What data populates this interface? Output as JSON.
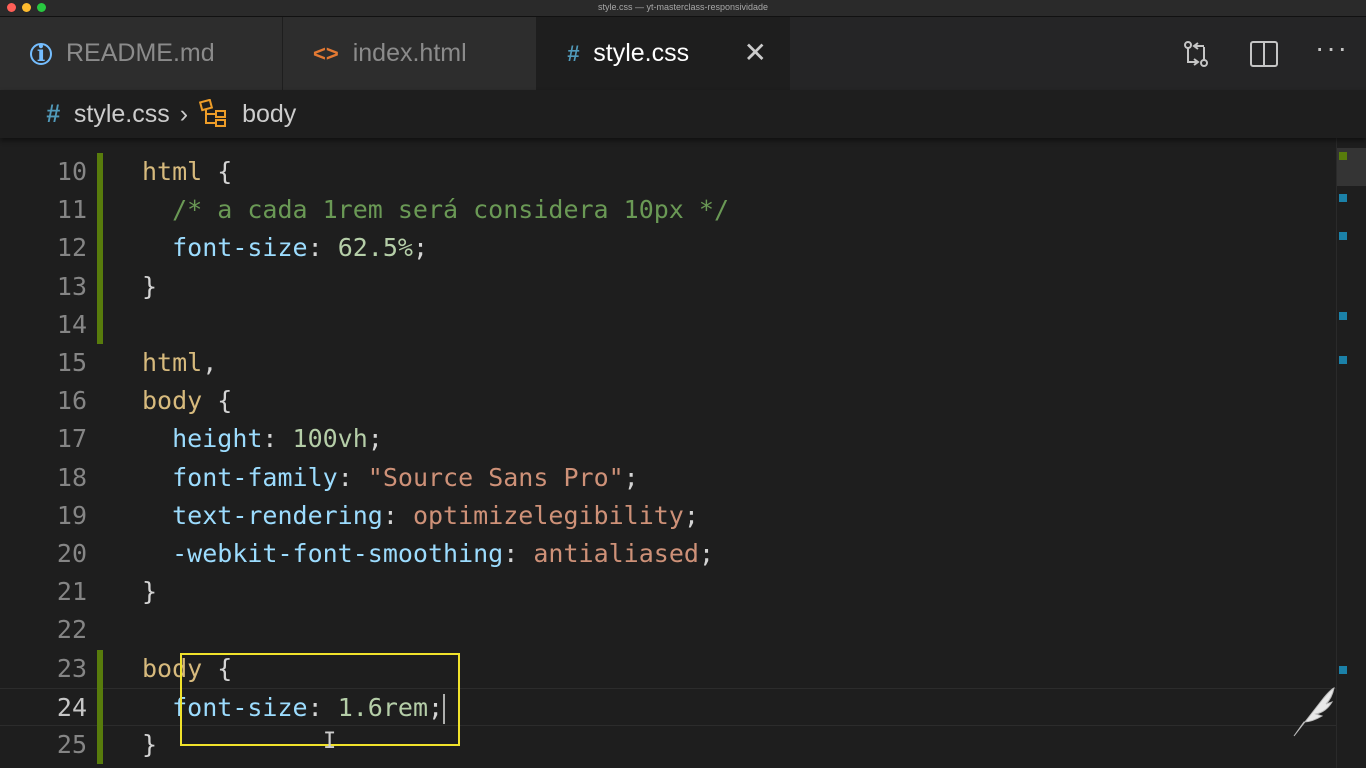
{
  "window": {
    "title": "style.css — yt-masterclass-responsividade"
  },
  "tabs": [
    {
      "label": "README.md",
      "icon": "info-icon",
      "active": false
    },
    {
      "label": "index.html",
      "icon": "code-icon",
      "active": false
    },
    {
      "label": "style.css",
      "icon": "hash-icon",
      "active": true
    }
  ],
  "tab_actions": [
    "compare-changes-icon",
    "split-editor-icon",
    "more-actions-icon"
  ],
  "breadcrumb": {
    "file": "style.css",
    "symbol": "body"
  },
  "editor": {
    "lines": [
      {
        "n": "10",
        "tokens": [
          [
            "sel",
            "html"
          ],
          [
            "punc",
            " {"
          ]
        ]
      },
      {
        "n": "11",
        "tokens": [
          [
            "punc",
            "  "
          ],
          [
            "cmt",
            "/* a cada 1rem será considera 10px */"
          ]
        ]
      },
      {
        "n": "12",
        "tokens": [
          [
            "punc",
            "  "
          ],
          [
            "prop",
            "font-size"
          ],
          [
            "punc",
            ": "
          ],
          [
            "num",
            "62.5%"
          ],
          [
            "punc",
            ";"
          ]
        ]
      },
      {
        "n": "13",
        "tokens": [
          [
            "punc",
            "}"
          ]
        ]
      },
      {
        "n": "14",
        "tokens": []
      },
      {
        "n": "15",
        "tokens": [
          [
            "sel",
            "html"
          ],
          [
            "punc",
            ","
          ]
        ]
      },
      {
        "n": "16",
        "tokens": [
          [
            "sel",
            "body"
          ],
          [
            "punc",
            " {"
          ]
        ]
      },
      {
        "n": "17",
        "tokens": [
          [
            "punc",
            "  "
          ],
          [
            "prop",
            "height"
          ],
          [
            "punc",
            ": "
          ],
          [
            "num",
            "100vh"
          ],
          [
            "punc",
            ";"
          ]
        ]
      },
      {
        "n": "18",
        "tokens": [
          [
            "punc",
            "  "
          ],
          [
            "prop",
            "font-family"
          ],
          [
            "punc",
            ": "
          ],
          [
            "str",
            "\"Source Sans Pro\""
          ],
          [
            "punc",
            ";"
          ]
        ]
      },
      {
        "n": "19",
        "tokens": [
          [
            "punc",
            "  "
          ],
          [
            "prop",
            "text-rendering"
          ],
          [
            "punc",
            ": "
          ],
          [
            "str",
            "optimizelegibility"
          ],
          [
            "punc",
            ";"
          ]
        ]
      },
      {
        "n": "20",
        "tokens": [
          [
            "punc",
            "  "
          ],
          [
            "prop",
            "-webkit-font-smoothing"
          ],
          [
            "punc",
            ": "
          ],
          [
            "str",
            "antialiased"
          ],
          [
            "punc",
            ";"
          ]
        ]
      },
      {
        "n": "21",
        "tokens": [
          [
            "punc",
            "}"
          ]
        ]
      },
      {
        "n": "22",
        "tokens": []
      },
      {
        "n": "23",
        "tokens": [
          [
            "sel",
            "body"
          ],
          [
            "punc",
            " {"
          ]
        ]
      },
      {
        "n": "24",
        "tokens": [
          [
            "punc",
            "  "
          ],
          [
            "prop",
            "font-size"
          ],
          [
            "punc",
            ": "
          ],
          [
            "num",
            "1.6rem"
          ],
          [
            "punc",
            ";"
          ]
        ],
        "current": true
      },
      {
        "n": "25",
        "tokens": [
          [
            "punc",
            "}"
          ]
        ]
      }
    ],
    "modified_line_ranges": [
      [
        "10",
        "14"
      ],
      [
        "23",
        "25"
      ]
    ]
  },
  "colors": {
    "selector": "#d7ba7d",
    "property": "#9cdcfe",
    "number": "#b5cea8",
    "string": "#ce9178",
    "comment": "#6a9955",
    "gutter_modified": "#587c0c",
    "highlight_box": "#f0e22b"
  }
}
